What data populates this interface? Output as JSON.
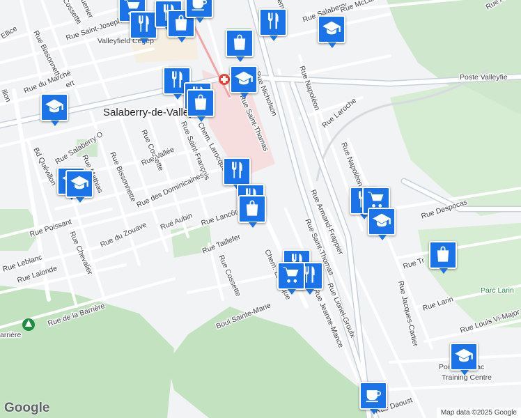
{
  "map": {
    "town": "Salaberry-de-Valleyfield",
    "cegep": "Valleyfield Cegep",
    "poste": "Poste Valleyfie",
    "park": "Parc Larin",
    "training": [
      "Pointe-du-Lac",
      "Training Centre"
    ],
    "barriere": "arrière",
    "street_labels": [
      "Rue Bissonnette",
      "Rue Saint-Joseph",
      "Ellice",
      "Cossette",
      "Rue du Marché",
      "Rue Salaberry O",
      "Bd Quévillon",
      "Rue Saint-François",
      "Rue Cossette",
      "Rue Bissonnette",
      "Rue Mathias",
      "Rue Vallée",
      "Rue des Dominicaines",
      "Rue du Zouave",
      "Rue Aubin",
      "Rue Poissant",
      "Rue Leblanc",
      "Rue Lalonde",
      "Rue Chevalier",
      "Rue de la Barrière",
      "Rue Taillefer",
      "Rue Cossette",
      "Boul Sainte-Marie",
      "Chem. Larocque",
      "Rue Saint-Thomas",
      "Rue Nicholson",
      "Rue Napoléon",
      "Rue Laroche",
      "Rue Napoléon",
      "Rue Armand-Frappier",
      "Rue Saint-Thomas",
      "Rue Jeanne-Mance",
      "Rue Lionel-Groulx",
      "Rue Jacques-Cartier",
      "Rue Despocas",
      "Rue Larin",
      "Rue Louis Vi-Major",
      "Rue Daoust",
      "Rue Salaberry",
      "Rue McLaren",
      "Rue Lancôt",
      "Rue Tr"
    ],
    "icons": [
      "shopping-cart-icon",
      "restaurant-icon",
      "restaurant-icon",
      "shopping-bag-icon",
      "coffee-icon",
      "restaurant-icon",
      "shopping-bag-icon",
      "school-icon",
      "school-icon",
      "restaurant-icon",
      "restaurant-icon",
      "shopping-bag-icon",
      "school-icon",
      "restaurant-icon",
      "school-icon",
      "school-icon",
      "restaurant-icon",
      "restaurant-icon",
      "shopping-bag-icon",
      "shopping-cart-icon",
      "school-icon",
      "shopping-bag-icon",
      "restaurant-icon",
      "restaurant-icon",
      "shopping-cart-icon",
      "school-icon",
      "coffee-icon",
      "hospital-icon",
      "park-icon"
    ],
    "partial_labels": [
      "uenier",
      "emie",
      "Rue A",
      "ert",
      "illon",
      "ôté"
    ]
  },
  "attribution": {
    "logo": "Google",
    "text": "Map data ©2025 Google"
  },
  "colors": {
    "marker": "#1a73e8",
    "road": "#ffffff",
    "major_road": "#c8d0da",
    "park": "#cfe8cd",
    "forest": "#c3e3c0",
    "hospital": "#f3d7d7"
  }
}
